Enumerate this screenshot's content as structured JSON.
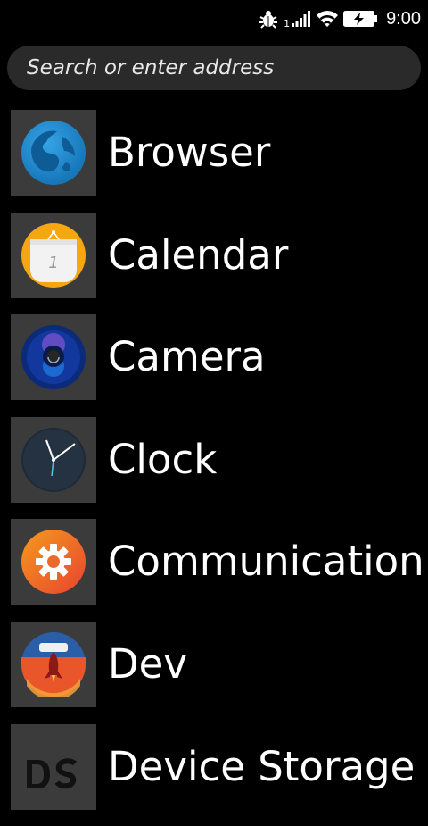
{
  "status_bar": {
    "time": "9:00",
    "sim_slot": "1",
    "icons": [
      "bug-icon",
      "signal-icon",
      "wifi-icon",
      "battery-charging-icon"
    ]
  },
  "search": {
    "placeholder": "Search or enter address"
  },
  "apps": [
    {
      "label": "Browser",
      "icon": "firefox-browser-icon"
    },
    {
      "label": "Calendar",
      "icon": "calendar-icon"
    },
    {
      "label": "Camera",
      "icon": "camera-icon"
    },
    {
      "label": "Clock",
      "icon": "clock-icon"
    },
    {
      "label": "Communication",
      "icon": "communication-gear-icon"
    },
    {
      "label": "Dev",
      "icon": "rocket-icon"
    },
    {
      "label": "Device Storage",
      "icon": "device-storage-icon"
    }
  ]
}
